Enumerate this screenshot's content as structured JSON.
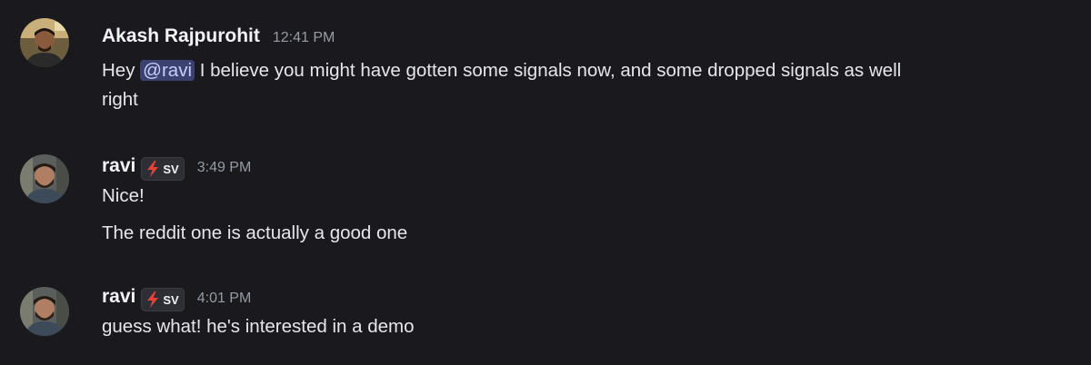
{
  "messages": [
    {
      "author": "Akash Rajpurohit",
      "timestamp": "12:41 PM",
      "avatar": "akash-avatar",
      "text_before_mention": "Hey ",
      "mention": "@ravi",
      "text_after_mention": " I believe you might have gotten some signals now, and some dropped signals as well",
      "text_continued": "right"
    },
    {
      "author": "ravi",
      "badge_icon": "lightning-icon",
      "badge_text": "SV",
      "timestamp": "3:49 PM",
      "avatar": "ravi-avatar",
      "lines": [
        "Nice!",
        "The reddit one is actually a good one"
      ]
    },
    {
      "author": "ravi",
      "badge_icon": "lightning-icon",
      "badge_text": "SV",
      "timestamp": "4:01 PM",
      "avatar": "ravi-avatar",
      "lines": [
        "guess what! he's interested in a demo"
      ]
    }
  ],
  "colors": {
    "background": "#1a1a1e",
    "username": "#f2f3f5",
    "timestamp": "#949ba4",
    "message_text": "#e6e7ea",
    "mention_bg": "#3c4270",
    "mention_text": "#c9cdfb",
    "badge_icon": "#e8413a"
  }
}
